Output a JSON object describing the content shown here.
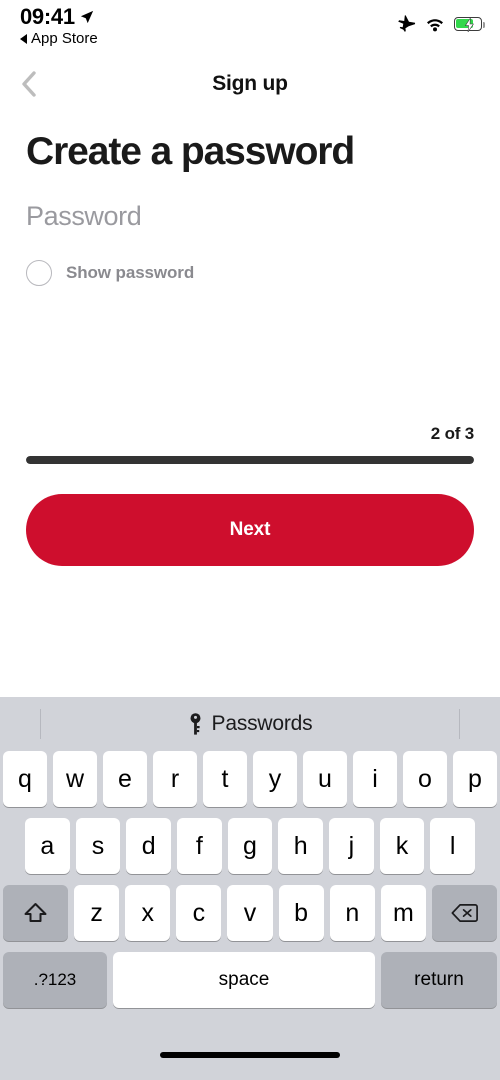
{
  "status_bar": {
    "time": "09:41",
    "back_app_label": "App Store",
    "icons": [
      "location-arrow-icon",
      "airplane-mode-icon",
      "wifi-icon",
      "battery-charging-icon"
    ],
    "battery_level_percent": 72
  },
  "nav": {
    "title": "Sign up",
    "back_icon": "chevron-left-icon"
  },
  "main": {
    "heading": "Create a password",
    "password_placeholder": "Password",
    "password_value": "",
    "show_password_label": "Show password",
    "show_password_checked": false
  },
  "progress": {
    "count_label": "2 of 3",
    "current_step": 2,
    "total_steps": 3,
    "fill_percent": 100,
    "fill_color": "#333333"
  },
  "cta": {
    "next_label": "Next",
    "color": "#CE0E2D"
  },
  "keyboard": {
    "suggestion_label": "Passwords",
    "suggestion_icon": "key-icon",
    "row1": [
      "q",
      "w",
      "e",
      "r",
      "t",
      "y",
      "u",
      "i",
      "o",
      "p"
    ],
    "row2": [
      "a",
      "s",
      "d",
      "f",
      "g",
      "h",
      "j",
      "k",
      "l"
    ],
    "row3": [
      "z",
      "x",
      "c",
      "v",
      "b",
      "n",
      "m"
    ],
    "shift_icon": "shift-arrow-icon",
    "backspace_icon": "backspace-delete-icon",
    "numeric_label": ".?123",
    "space_label": "space",
    "return_label": "return"
  }
}
